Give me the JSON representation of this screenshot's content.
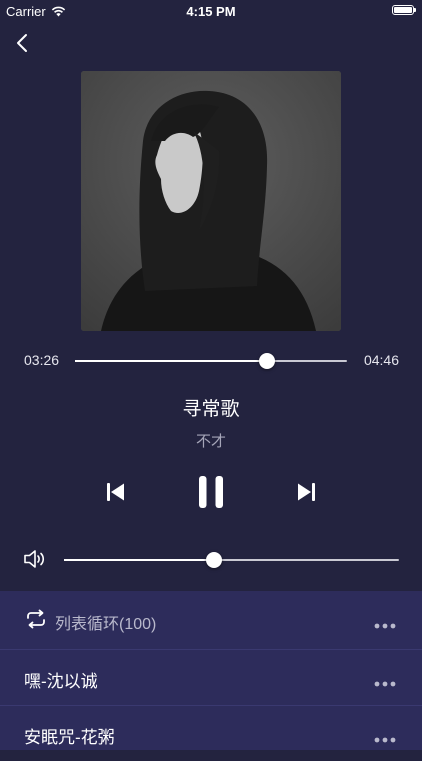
{
  "status_bar": {
    "carrier": "Carrier",
    "time": "4:15 PM",
    "icons": [
      "wifi-icon",
      "battery-icon"
    ]
  },
  "navigation": {
    "back_icon": "chevron-left-icon"
  },
  "player": {
    "current_time": "03:26",
    "total_time": "04:46",
    "progress_fraction": 0.706,
    "song_title": "寻常歌",
    "artist": "不才",
    "volume_fraction": 0.449,
    "controls": [
      "previous-icon",
      "pause-icon",
      "next-icon"
    ]
  },
  "playlist": {
    "mode_label": "列表循环(100)",
    "mode_icon": "repeat-icon",
    "items": [
      {
        "name": "嘿-沈以诚"
      },
      {
        "name": "安眠咒-花粥"
      }
    ]
  },
  "colors": {
    "background": "#23233f",
    "playlist_background": "#2d2c5b",
    "secondary_text": "#a5a5b8"
  }
}
